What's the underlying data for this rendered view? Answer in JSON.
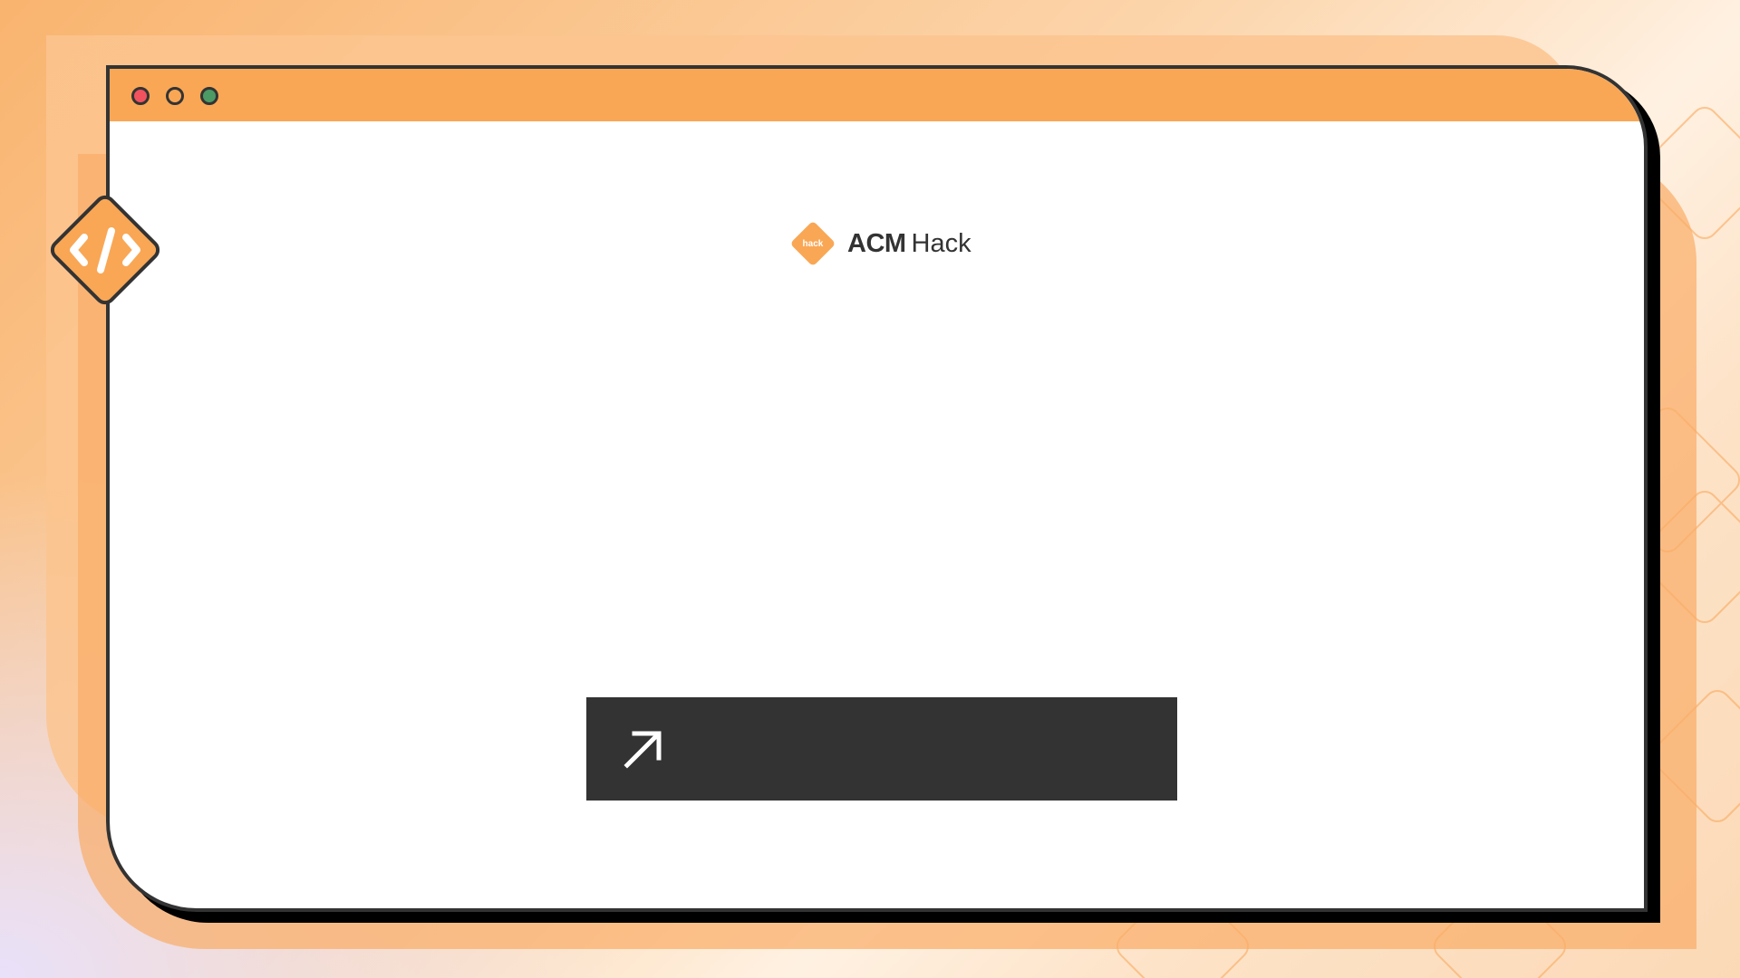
{
  "window": {
    "controls": {
      "close_color": "#f1525e",
      "minimize_color": "#f9a755",
      "maximize_color": "#4c9a64"
    },
    "titlebar_color": "#f9a755"
  },
  "logo": {
    "mark_text": "hack",
    "brand_bold": "ACM",
    "brand_light": "Hack"
  },
  "cta": {
    "icon": "arrow-up-right-icon",
    "background": "#333333"
  },
  "badge": {
    "icon": "code-icon",
    "glyph": "</>"
  },
  "colors": {
    "accent": "#f9a755",
    "dark": "#333333"
  }
}
